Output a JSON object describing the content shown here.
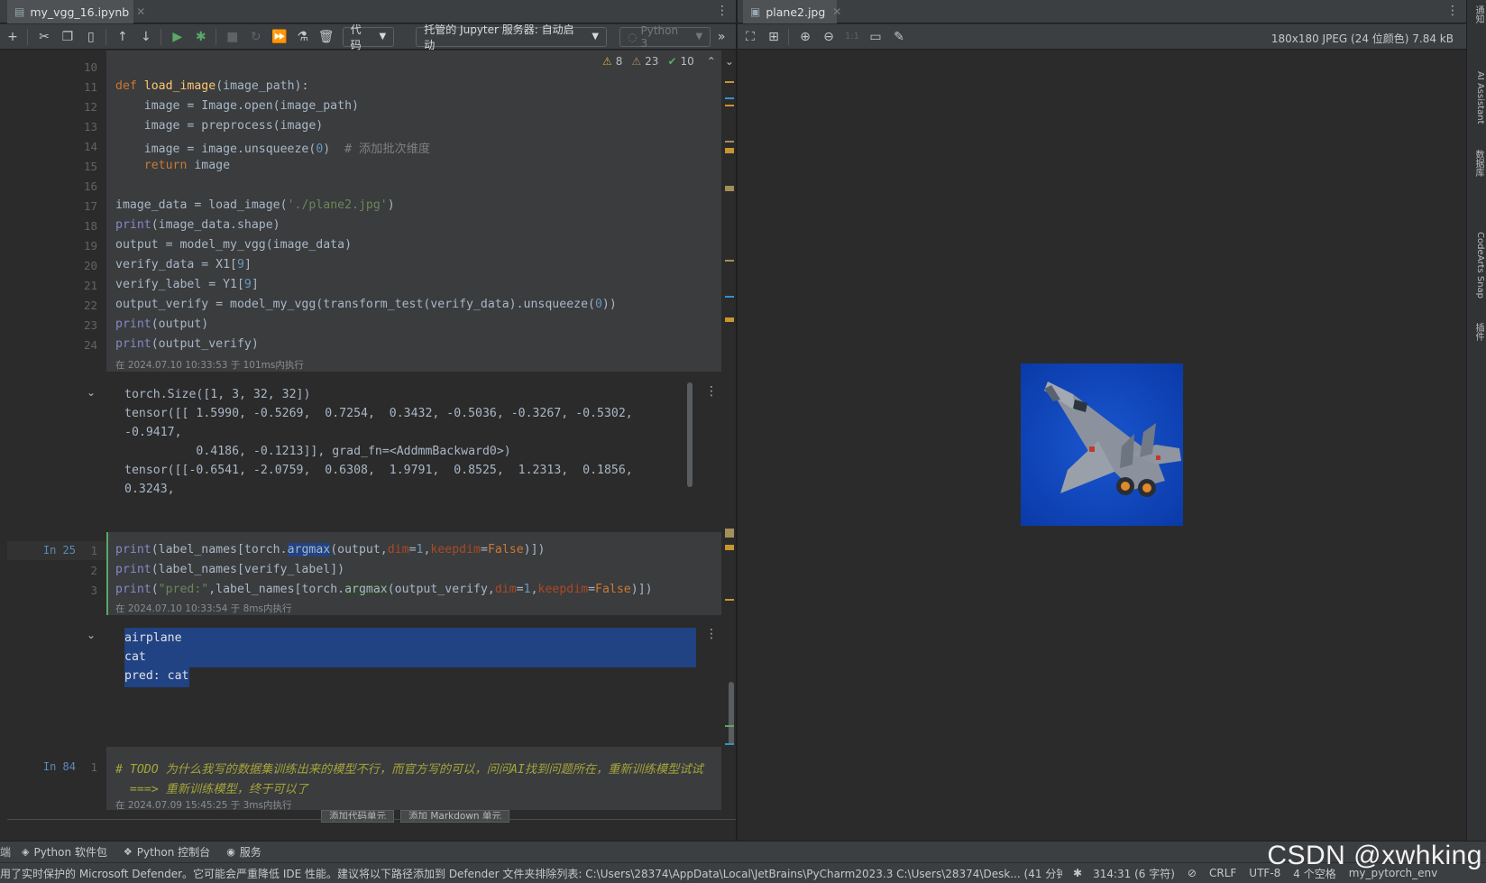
{
  "editor_tab": {
    "title": "my_vgg_16.ipynb"
  },
  "viewer_tab": {
    "title": "plane2.jpg"
  },
  "toolbar": {
    "cell_type": "代码",
    "server": "托管的 Jupyter 服务器: 自动启动",
    "kernel": "Python 3"
  },
  "inspection": {
    "warnings": "8",
    "weak": "23",
    "ok": "10"
  },
  "cell1": {
    "line_numbers": [
      "10",
      "11",
      "12",
      "13",
      "14",
      "15",
      "16",
      "17",
      "18",
      "19",
      "20",
      "21",
      "22",
      "23",
      "24"
    ],
    "meta": "在 2024.07.10 10:33:53 于 101ms内执行"
  },
  "output1": {
    "lines": [
      "torch.Size([1, 3, 32, 32])",
      "tensor([[ 1.5990, -0.5269,  0.7254,  0.3432, -0.5036, -0.3267, -0.5302,",
      "-0.9417,",
      "          0.4186, -0.1213]], grad_fn=<AddmmBackward0>)",
      "tensor([[-0.6541, -2.0759,  0.6308,  1.9791,  0.8525,  1.2313,  0.1856,",
      "0.3243,"
    ]
  },
  "cell2": {
    "label": "In 25",
    "line_numbers": [
      "1",
      "2",
      "3"
    ],
    "meta": "在 2024.07.10 10:33:54 于 8ms内执行"
  },
  "output2": {
    "lines": [
      "airplane",
      "cat",
      "pred: cat"
    ]
  },
  "cell3": {
    "label": "In 84",
    "line_numbers": [
      "1"
    ],
    "comment_line1": "# TODO 为什么我写的数据集训练出来的模型不行，而官方写的可以，问问AI找到问题所在，重新训练模型试试",
    "comment_line2": "  ===> 重新训练模型，终于可以了",
    "meta": "在 2024.07.09 15:45:25 于 3ms内执行"
  },
  "cell_add_bar": {
    "add_code": "添加代码单元",
    "add_markdown": "添加 Markdown 单元"
  },
  "viewer": {
    "info": "180x180 JPEG (24 位颜色) 7.84 kB",
    "one_to_one": "1:1"
  },
  "right_strip": {
    "items": [
      "通知",
      "AI Assistant",
      "数据库",
      "CodeArts Snap",
      "插件"
    ]
  },
  "status_top": {
    "items": [
      "Python 软件包",
      "Python 控制台",
      "服务"
    ]
  },
  "status_bottom": {
    "message": "用了实时保护的 Microsoft Defender。它可能会严重降低 IDE 性能。建议将以下路径添加到 Defender 文件夹排除列表: C:\\Users\\28374\\AppData\\Local\\JetBrains\\PyCharm2023.3 C:\\Users\\28374\\Desk... (41 分钟之前)",
    "position": "314:31 (6 字符)",
    "line_sep": "CRLF",
    "encoding": "UTF-8",
    "indent": "4 个空格",
    "interpreter": "my_pytorch_env"
  },
  "watermark": "CSDN @xwhking",
  "colors": {
    "accent_selection": "#214283",
    "editor_bg": "#2b2b2b",
    "panel_bg": "#3c3f41"
  }
}
